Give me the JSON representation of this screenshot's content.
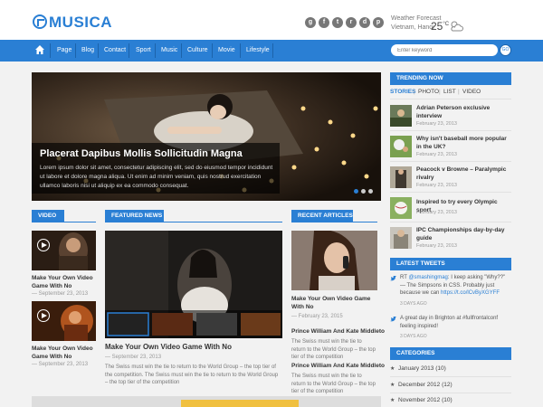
{
  "brand": {
    "name": "MUSICA"
  },
  "social": [
    {
      "icon": "google-plus-icon",
      "glyph": "g"
    },
    {
      "icon": "facebook-icon",
      "glyph": "f"
    },
    {
      "icon": "twitter-icon",
      "glyph": "t"
    },
    {
      "icon": "rss-icon",
      "glyph": "r"
    },
    {
      "icon": "dribbble-icon",
      "glyph": "d"
    },
    {
      "icon": "pinterest-icon",
      "glyph": "p"
    }
  ],
  "weather": {
    "label": "Weather Forecast",
    "place": "Vietnam, Hanoi",
    "temp": "25",
    "unit": "C",
    "icon": "partly-cloudy-icon"
  },
  "nav": {
    "home_icon": "home-icon",
    "items": [
      "Page",
      "Blog",
      "Contact",
      "Sport",
      "Music",
      "Culture",
      "Movie",
      "Lifestyle"
    ]
  },
  "search": {
    "placeholder": "Enter keyword",
    "button": "GO"
  },
  "slider": {
    "title": "Placerat Dapibus Mollis Sollicitudin Magna",
    "text": "Lorem ipsum dolor sit amet, consectetur adipiscing elit, sed do eiusmod tempor incididunt ut labore et dolore magna aliqua. Ut enim ad minim veniam, quis nostrud exercitation ullamco laboris nisi ut aliquip ex ea commodo consequat."
  },
  "video": {
    "heading": "VIDEO",
    "items": [
      {
        "title": "Make Your Own Video Game With No",
        "date": "— September 23, 2013"
      },
      {
        "title": "Make Your Own Video Game With No",
        "date": "— September 23, 2013"
      }
    ]
  },
  "featured": {
    "heading": "FEATURED NEWS",
    "title": "Make Your Own Video Game With No",
    "date": "— September 23, 2013",
    "text": "The Swiss must win the tie to return to the World Group – the top tier of the competition. The Swiss must win the tie to return to the World Group – the top tier of the competition"
  },
  "recent": {
    "heading": "RECENT ARTICLES",
    "main_title": "Make Your Own Video Game With No",
    "main_date": "— February 23, 2015",
    "items": [
      {
        "title": "Prince William And Kate Middleto",
        "text": "The Swiss must win the tie to return to the World Group – the top tier of the competition"
      },
      {
        "title": "Prince William And Kate Middleto",
        "text": "The Swiss must win the tie to return to the World Group – the top tier of the competition"
      }
    ]
  },
  "trending": {
    "heading": "TRENDING NOW",
    "tabs": [
      "STORIES",
      "PHOTO",
      "LIST",
      "VIDEO"
    ],
    "active_tab": "STORIES",
    "items": [
      {
        "title": "Adrian Peterson exclusive interview",
        "date": "February 23, 2013"
      },
      {
        "title": "Why isn't baseball more popular in the UK?",
        "date": "February 23, 2013"
      },
      {
        "title": "Peacock v Browne – Paralympic rivalry",
        "date": "February 23, 2013"
      },
      {
        "title": "Inspired to try every Olympic sport",
        "date": "February 23, 2013"
      },
      {
        "title": "IPC Championships day-by-day guide",
        "date": "February 23, 2013"
      }
    ]
  },
  "tweets": {
    "heading": "LATEST TWEETS",
    "items": [
      {
        "pre": "RT ",
        "handle": "@smashingmag",
        "text": ": I keep asking \"Why??\" — The Simpsons in CSS. Probably just because we can ",
        "link": "https://t.co/lCvByXGYFF",
        "ago": "3 DAYS AGO"
      },
      {
        "pre": "",
        "handle": "",
        "text": "A great day in Brighton at #fullfrontalconf feeling inspired!",
        "link": "",
        "ago": "3 DAYS AGO"
      }
    ]
  },
  "categories": {
    "heading": "CATEGORIES",
    "items": [
      {
        "name": "January 2013",
        "count": "(10)"
      },
      {
        "name": "December 2012",
        "count": "(12)"
      },
      {
        "name": "November 2012",
        "count": "(10)"
      }
    ]
  },
  "colors": {
    "accent": "#2a7fd4",
    "background": "#f2f2f2"
  }
}
